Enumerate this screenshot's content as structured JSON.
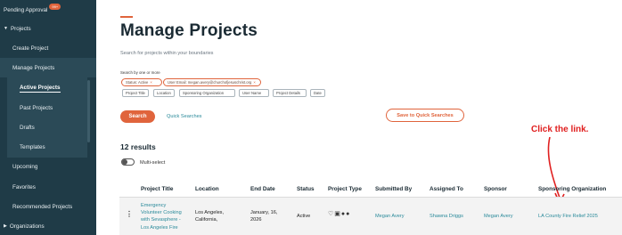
{
  "sidebar": {
    "pending_approval": "Pending Approval",
    "pending_badge": "99+",
    "projects": "Projects",
    "create_project": "Create Project",
    "manage_projects": "Manage Projects",
    "active_projects": "Active Projects",
    "past_projects": "Past Projects",
    "drafts": "Drafts",
    "templates": "Templates",
    "upcoming": "Upcoming",
    "favorites": "Favorites",
    "recommended_projects": "Recommended Projects",
    "organizations": "Organizations"
  },
  "page": {
    "title": "Manage Projects",
    "subtitle": "Search for projects within your boundaries",
    "search_label": "Search by one or more"
  },
  "filters": {
    "active_chips": [
      "Status: Active",
      "User Email: megan.avery@churchofjesuschrist.org"
    ],
    "options": [
      "Project Title",
      "Location",
      "Sponsoring Organization",
      "User Name",
      "Project Details",
      "Date"
    ]
  },
  "actions": {
    "search": "Search",
    "quick_searches": "Quick Searches",
    "save_quick": "Save to Quick Searches"
  },
  "results": {
    "count_label": "12 results",
    "multi_select": "Multi-select"
  },
  "annotation": {
    "text": "Click the link."
  },
  "table": {
    "headers": [
      "Project Title",
      "Location",
      "End Date",
      "Status",
      "Project Type",
      "Submitted By",
      "Assigned To",
      "Sponsor",
      "Sponsoring Organization"
    ],
    "row": {
      "title_lines": [
        "Emergency",
        "Volunteer Cooking",
        "with Sevasphere -",
        "Los Angeles Fire"
      ],
      "location_lines": [
        "Los Angeles,",
        "California,"
      ],
      "end_date_lines": [
        "January, 16,",
        "2026"
      ],
      "status": "Active",
      "project_type_icons": [
        "hand-heart-icon",
        "screen-icon",
        "group-icon"
      ],
      "submitted_by": "Megan Avery",
      "assigned_to": "Shawna Driggs",
      "sponsor": "Megan Avery",
      "sponsoring_org": "LA County Fire Relief 2025"
    }
  },
  "colors": {
    "sidebar_bg": "#1f3b47",
    "accent": "#e0643c",
    "link": "#2a8a9a",
    "annotation": "#e02020"
  }
}
